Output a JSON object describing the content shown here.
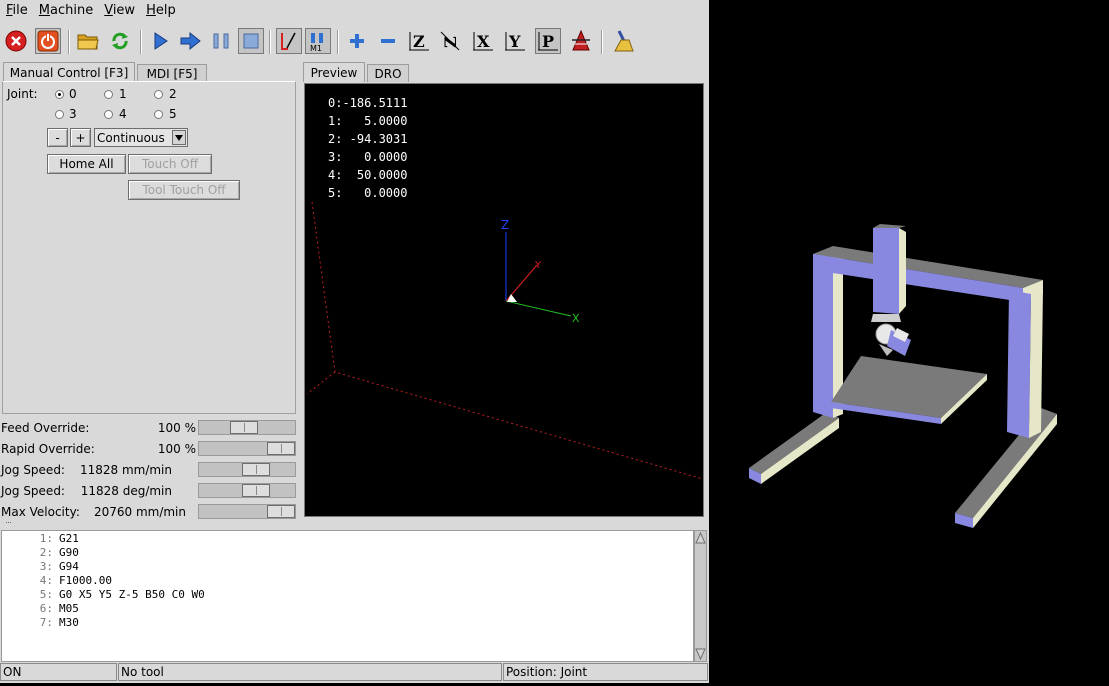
{
  "menubar": {
    "items": [
      {
        "label": "File",
        "key": "F",
        "rest": "ile"
      },
      {
        "label": "Machine",
        "key": "M",
        "rest": "achine"
      },
      {
        "label": "View",
        "key": "V",
        "rest": "iew"
      },
      {
        "label": "Help",
        "key": "H",
        "rest": "elp"
      }
    ]
  },
  "toolbar": {
    "buttons": [
      {
        "name": "estop-button",
        "icon": "estop-icon"
      },
      {
        "name": "machine-power-button",
        "icon": "power-icon"
      },
      {
        "name": "open-file-button",
        "icon": "folder-icon"
      },
      {
        "name": "reload-file-button",
        "icon": "reload-icon"
      },
      {
        "name": "run-button",
        "icon": "run-icon"
      },
      {
        "name": "step-button",
        "icon": "step-icon"
      },
      {
        "name": "pause-button",
        "icon": "pause-icon"
      },
      {
        "name": "stop-button",
        "icon": "stop-icon"
      },
      {
        "name": "block-delete-toggle",
        "icon": "block-delete-icon"
      },
      {
        "name": "optional-stop-toggle",
        "icon": "optional-stop-icon",
        "text": "M1"
      },
      {
        "name": "zoom-in-button",
        "icon": "zoom-in-icon"
      },
      {
        "name": "zoom-out-button",
        "icon": "zoom-out-icon"
      },
      {
        "name": "view-z-button",
        "icon": "view-z-icon",
        "text": "Z"
      },
      {
        "name": "view-z2-button",
        "icon": "view-rotated-z-icon",
        "text": "Z"
      },
      {
        "name": "view-x-button",
        "icon": "view-x-icon",
        "text": "X"
      },
      {
        "name": "view-y-button",
        "icon": "view-y-icon",
        "text": "Y"
      },
      {
        "name": "view-p-button",
        "icon": "view-perspective-icon",
        "text": "P"
      },
      {
        "name": "rotate-view-button",
        "icon": "rotate-icon"
      },
      {
        "name": "clear-plot-button",
        "icon": "clear-broom-icon"
      }
    ],
    "colors": {
      "estop": "#d42020",
      "power": "#e05020",
      "folder": "#d8a020",
      "reload": "#22a022",
      "blue": "#3070d0"
    }
  },
  "left_tabs": [
    "Manual Control [F3]",
    "MDI [F5]"
  ],
  "right_tabs": [
    "Preview",
    "DRO"
  ],
  "manual": {
    "joint_label": "Joint:",
    "joints": [
      "0",
      "1",
      "2",
      "3",
      "4",
      "5"
    ],
    "selected_joint": "0",
    "jog_minus": "-",
    "jog_plus": "+",
    "jog_mode": "Continuous",
    "home_all": "Home All",
    "touch_off": "Touch Off",
    "tool_touch_off": "Tool Touch Off"
  },
  "overrides": [
    {
      "label": "Feed Override:",
      "value": "100 %",
      "fraction": 0.45
    },
    {
      "label": "Rapid Override:",
      "value": "100 %",
      "fraction": 1.0
    },
    {
      "label": "Jog Speed:",
      "value": "11828 mm/min",
      "fraction": 0.63
    },
    {
      "label": "Jog Speed:",
      "value": "11828 deg/min",
      "fraction": 0.63
    },
    {
      "label": "Max Velocity:",
      "value": "20760 mm/min",
      "fraction": 1.0
    }
  ],
  "dro_lines": [
    "0:-186.5111",
    "1:   5.0000",
    "2: -94.3031",
    "3:   0.0000",
    "4:  50.0000",
    "5:   0.0000"
  ],
  "axes": {
    "z": "Z",
    "y": "Y",
    "x": "X"
  },
  "gcode": [
    {
      "n": "1:",
      "t": "G21"
    },
    {
      "n": "2:",
      "t": "G90"
    },
    {
      "n": "3:",
      "t": "G94"
    },
    {
      "n": "4:",
      "t": "F1000.00"
    },
    {
      "n": "5:",
      "t": "G0 X5 Y5 Z-5 B50 C0 W0"
    },
    {
      "n": "6:",
      "t": "M05"
    },
    {
      "n": "7:",
      "t": "M30"
    }
  ],
  "status": {
    "state": "ON",
    "tool": "No tool",
    "position": "Position: Joint"
  }
}
